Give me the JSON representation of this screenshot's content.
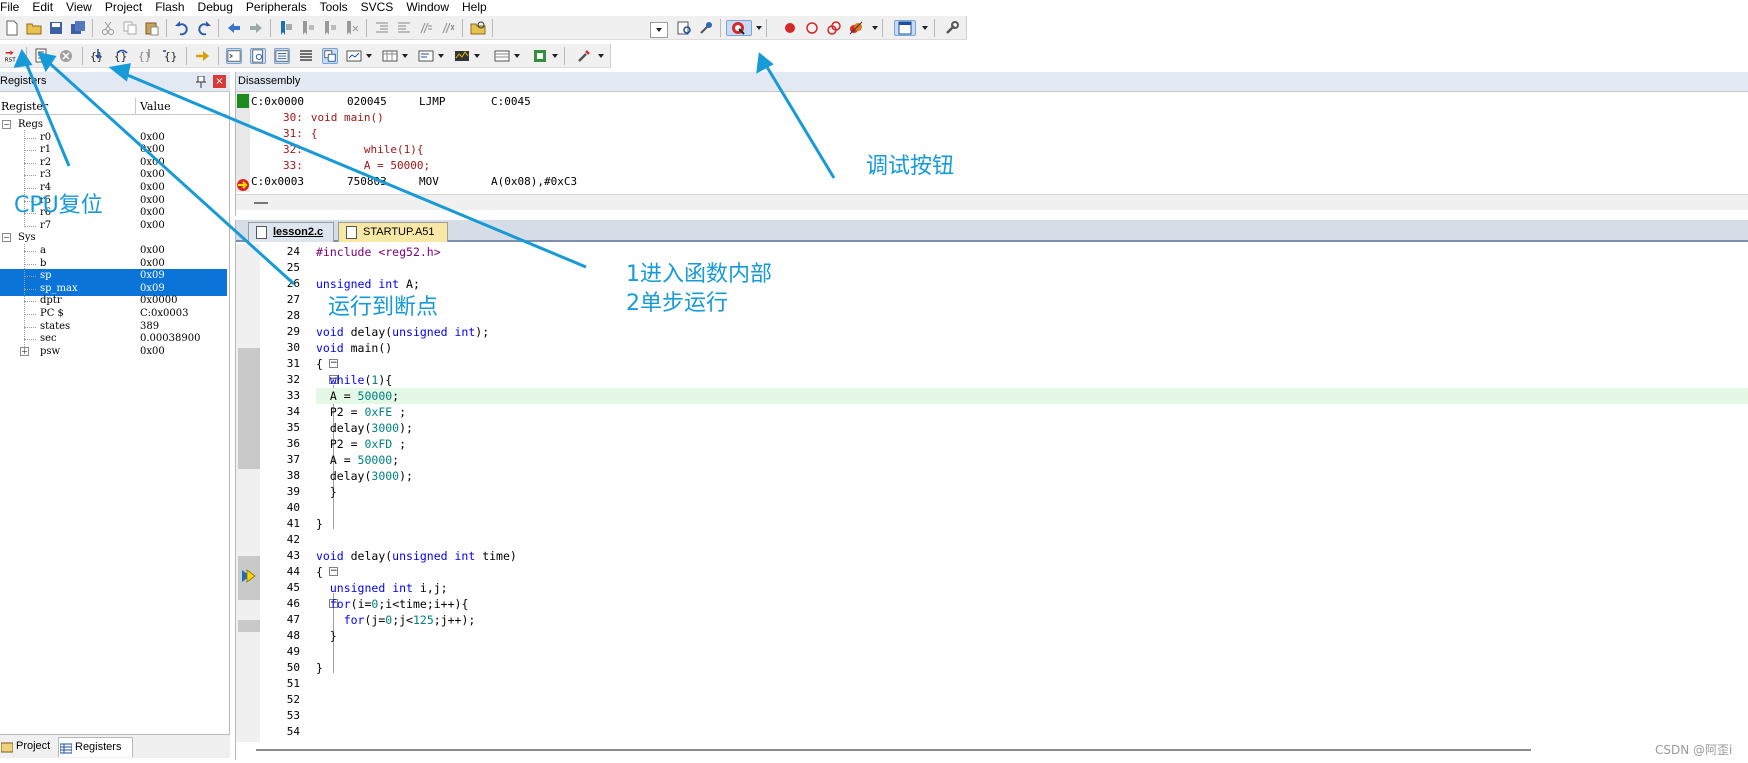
{
  "menubar": {
    "items": [
      "File",
      "Edit",
      "View",
      "Project",
      "Flash",
      "Debug",
      "Peripherals",
      "Tools",
      "SVCS",
      "Window",
      "Help"
    ]
  },
  "toolbar2": {
    "rst_label": "RST"
  },
  "registers_panel": {
    "title": "Registers",
    "col_register": "Register",
    "col_value": "Value",
    "rows": [
      {
        "name": "Regs",
        "value": "",
        "level": 0,
        "selected": false
      },
      {
        "name": "r0",
        "value": "0x00",
        "level": 1,
        "selected": false
      },
      {
        "name": "r1",
        "value": "0x00",
        "level": 1,
        "selected": false
      },
      {
        "name": "r2",
        "value": "0x00",
        "level": 1,
        "selected": false
      },
      {
        "name": "r3",
        "value": "0x00",
        "level": 1,
        "selected": false
      },
      {
        "name": "r4",
        "value": "0x00",
        "level": 1,
        "selected": false
      },
      {
        "name": "r5",
        "value": "0x00",
        "level": 1,
        "selected": false
      },
      {
        "name": "r6",
        "value": "0x00",
        "level": 1,
        "selected": false
      },
      {
        "name": "r7",
        "value": "0x00",
        "level": 1,
        "selected": false
      },
      {
        "name": "Sys",
        "value": "",
        "level": 0,
        "selected": false
      },
      {
        "name": "a",
        "value": "0x00",
        "level": 1,
        "selected": false
      },
      {
        "name": "b",
        "value": "0x00",
        "level": 1,
        "selected": false
      },
      {
        "name": "sp",
        "value": "0x09",
        "level": 1,
        "selected": true
      },
      {
        "name": "sp_max",
        "value": "0x09",
        "level": 1,
        "selected": true
      },
      {
        "name": "dptr",
        "value": "0x0000",
        "level": 1,
        "selected": false
      },
      {
        "name": "PC  $",
        "value": "C:0x0003",
        "level": 1,
        "selected": false
      },
      {
        "name": "states",
        "value": "389",
        "level": 1,
        "selected": false
      },
      {
        "name": "sec",
        "value": "0.00038900",
        "level": 1,
        "selected": false
      },
      {
        "name": "psw",
        "value": "0x00",
        "level": 1,
        "selected": false
      }
    ],
    "tabs": [
      "Project",
      "Registers"
    ]
  },
  "disassembly": {
    "title": "Disassembly",
    "lines": [
      {
        "addr": "C:0x0000",
        "opcode": "020045",
        "mnemonic": "LJMP",
        "operand": "C:0045",
        "source": false
      },
      {
        "addr": "",
        "lineno": "30:",
        "text": "void main()",
        "source": true
      },
      {
        "addr": "",
        "lineno": "31:",
        "text": "{",
        "source": true
      },
      {
        "addr": "",
        "lineno": "32:",
        "text": "        while(1){",
        "source": true
      },
      {
        "addr": "",
        "lineno": "33:",
        "text": "        A = 50000;",
        "source": true
      },
      {
        "addr": "C:0x0003",
        "opcode": "750803",
        "mnemonic": "MOV",
        "operand": "A(0x08),#0xC3",
        "source": false
      }
    ]
  },
  "editor": {
    "tabs": [
      "lesson2.c",
      "STARTUP.A51"
    ],
    "line_numbers": [
      "24",
      "25",
      "26",
      "27",
      "28",
      "29",
      "30",
      "31",
      "32",
      "33",
      "34",
      "35",
      "36",
      "37",
      "38",
      "39",
      "40",
      "41",
      "42",
      "43",
      "44",
      "45",
      "46",
      "47",
      "48",
      "49",
      "50",
      "51",
      "52",
      "53",
      "54"
    ],
    "code": [
      "#include <reg52.h>",
      "",
      "unsigned int A;",
      "",
      "",
      "void delay(unsigned int);",
      "void main()",
      "{",
      "  while(1){",
      "  A = 50000;",
      "  P2 = 0xFE ;",
      "  delay(3000);",
      "  P2 = 0xFD ;",
      "  A = 50000;",
      "  delay(3000);",
      "  }",
      "",
      "}",
      "",
      "void delay(unsigned int time)",
      "{",
      "  unsigned int i,j;",
      "  for(i=0;i<time;i++){",
      "    for(j=0;j<125;j++);",
      "  }",
      "",
      "}",
      "",
      "",
      "",
      ""
    ],
    "current_line": "33"
  },
  "annotations": {
    "cpu_reset": "CPU复位",
    "run_to_breakpoint": "运行到断点",
    "step_into_line1": "1进入函数内部",
    "step_into_line2": "2单步运行",
    "debug_button": "调试按钮",
    "color": "#169ad8"
  },
  "watermark": "CSDN @阿歪i"
}
